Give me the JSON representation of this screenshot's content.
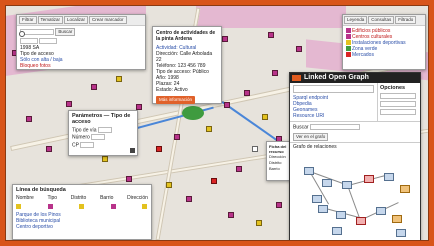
{
  "toolbar": {
    "tabs": [
      "Filtrar",
      "Tematizar",
      "Localizar",
      "Crear marcador"
    ],
    "search_label": "Buscar"
  },
  "left_panel": {
    "rows": [
      "1998 SA",
      "Tipo de acceso"
    ],
    "links": [
      "Sólo con alta / baja",
      "Bloqueo fotos"
    ]
  },
  "popup_main": {
    "title": "Centro de actividades de la pinta Ardena",
    "lines": [
      "Actividad: Cultural",
      "Dirección: Calle Arbolada 22",
      "Teléfono: 123 456 789",
      "Tipo de acceso: Público",
      "Año: 1998",
      "Plazas: 24",
      "Estado: Activo"
    ],
    "button": "Más información"
  },
  "popup_small": {
    "title": "Parámetros — Tipo de acceso",
    "rows": [
      "Tipo de vía",
      "Número",
      "CP"
    ]
  },
  "popup_mid": {
    "title": "Ficha del recurso",
    "lines": [
      "Dirección",
      "Distrito",
      "Barrio"
    ]
  },
  "right_panel": {
    "tabs": [
      "Leyenda",
      "Consultas",
      "Filtrado"
    ],
    "items": [
      "Edificios públicos",
      "Centros culturales",
      "Instalaciones deportivas",
      "Zona verde",
      "Mercados"
    ]
  },
  "bottom_panel": {
    "header": "Línea de búsqueda",
    "columns": [
      "Nombre",
      "Tipo",
      "Distrito",
      "Barrio",
      "Dirección"
    ],
    "row1": "Parque de los Pinos",
    "row2": "Biblioteca municipal",
    "row3": "Centro deportivo"
  },
  "lod": {
    "title": "Linked Open Graph",
    "section1": "Opciones",
    "links": [
      "Sparql endpoint",
      "Dbpedia",
      "Geonames",
      "Resource URI"
    ],
    "field_label": "Buscar",
    "action": "Ver en el grafo",
    "graph_label": "Grafo de relaciones"
  },
  "colors": {
    "accent": "#d8551a",
    "poi": "#b8338a",
    "zone": "#e296c8"
  }
}
